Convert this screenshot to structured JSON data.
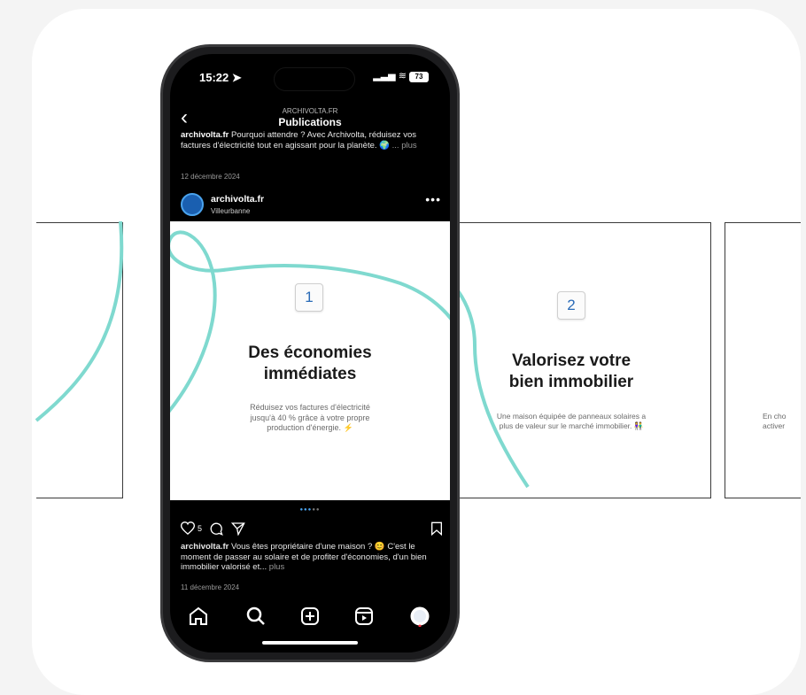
{
  "status_bar": {
    "time": "15:22",
    "battery": "73"
  },
  "nav": {
    "subtitle": "ARCHIVOLTA.FR",
    "title": "Publications",
    "back_icon": "chevron-left-icon"
  },
  "previous_post": {
    "username": "archivolta.fr",
    "caption": "Pourquoi attendre ? Avec Archivolta, réduisez vos factures d'électricité tout en agissant pour la planète.",
    "emoji": "🌍",
    "more": "... plus",
    "date": "12 décembre 2024"
  },
  "post": {
    "username": "archivolta.fr",
    "location": "Villeurbanne",
    "more_icon": "more-dots-icon",
    "slide": {
      "number": "1",
      "title_line1": "Des économies",
      "title_line2": "immédiates",
      "desc_line1": "Réduisez vos factures d'électricité",
      "desc_line2": "jusqu'à 40 % grâce à votre propre",
      "desc_line3": "production d'énergie. ⚡"
    },
    "like_count": "5",
    "caption_username": "archivolta.fr",
    "caption": "Vous êtes propriétaire d'une maison ? 😊 C'est le moment de passer au solaire et de profiter d'économies, d'un bien immobilier valorisé et...",
    "caption_more": "plus",
    "date": "11 décembre 2024"
  },
  "slide2": {
    "number": "2",
    "title_line1": "Valorisez votre",
    "title_line2": "bien immobilier",
    "desc_line1": "Une maison équipée de panneaux solaires a",
    "desc_line2": "plus de valeur sur le marché immobilier. 👫"
  },
  "slide3": {
    "desc_line1": "En cho",
    "desc_line2": "activer"
  },
  "tabbar": [
    "home-icon",
    "search-icon",
    "create-icon",
    "reels-icon",
    "profile-icon"
  ],
  "colors": {
    "accent_swirl": "#7fd9cf",
    "badge_number": "#2a6bb7",
    "phone_bg": "#000000"
  }
}
